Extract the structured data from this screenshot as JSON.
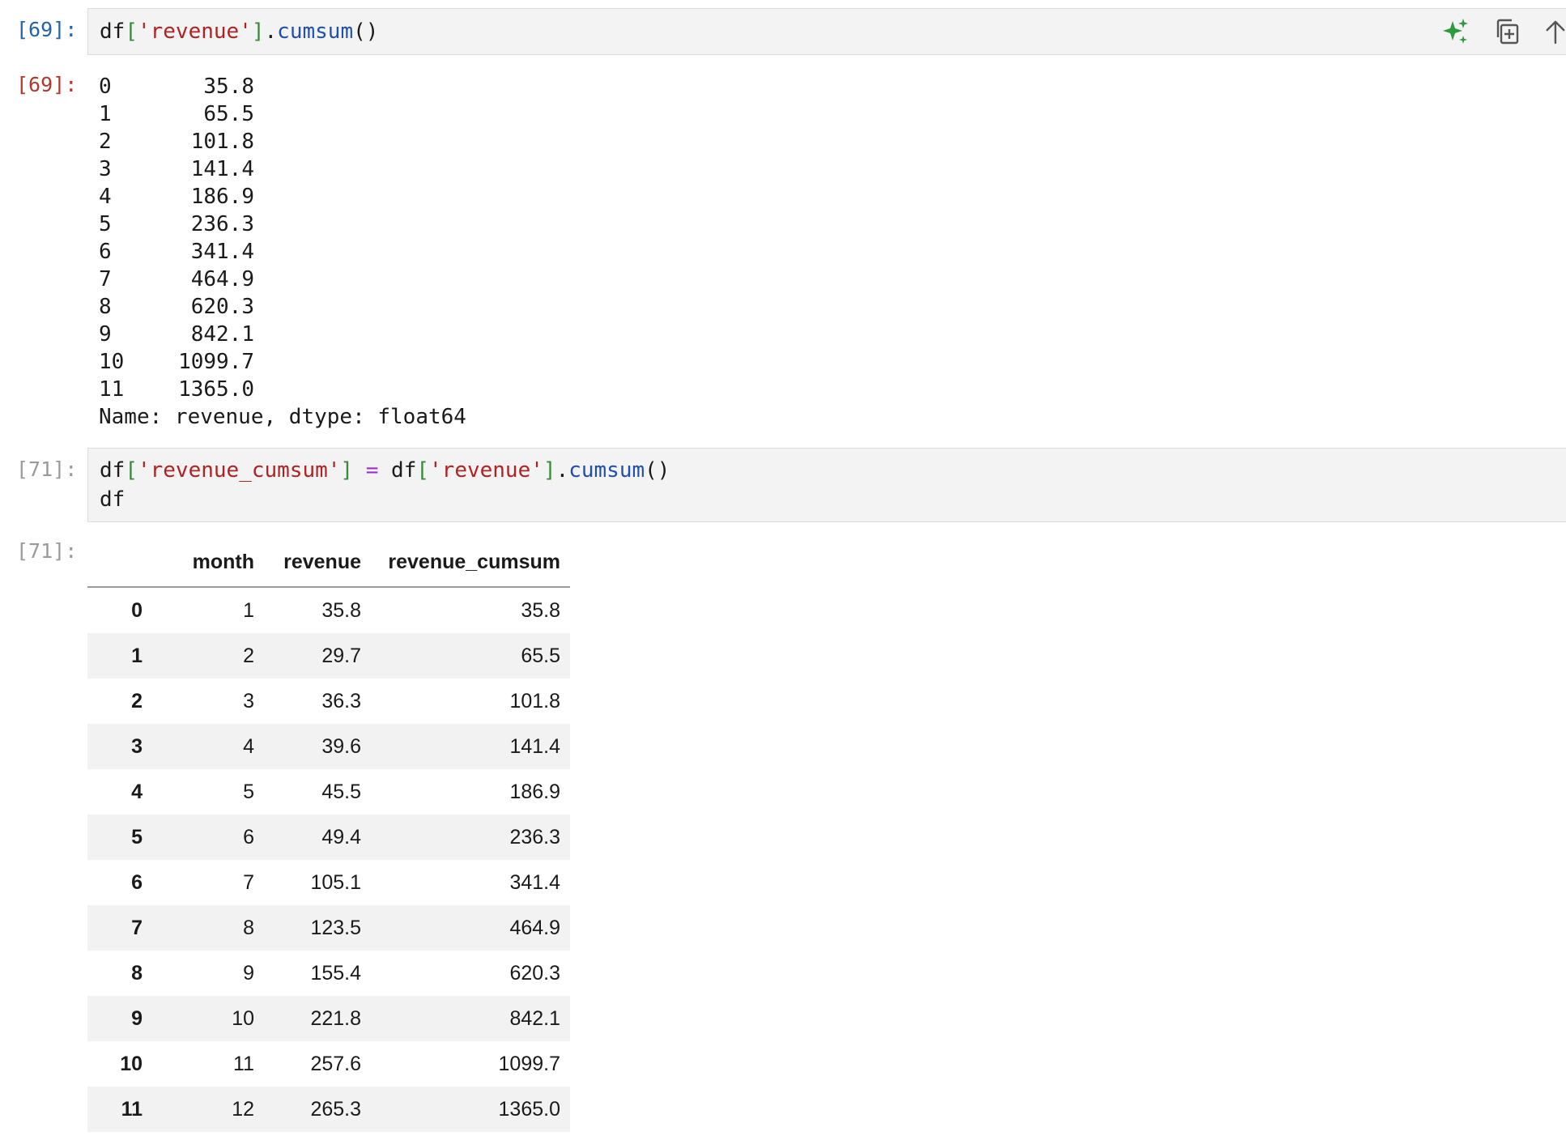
{
  "cell1": {
    "in_prompt": "[69]:",
    "code": {
      "df": "df",
      "open": "[",
      "key": "'revenue'",
      "close": "]",
      "dot": ".",
      "fn": "cumsum",
      "parens": "()"
    },
    "out_prompt": "[69]:",
    "series": [
      {
        "idx": "0",
        "val": "35.8"
      },
      {
        "idx": "1",
        "val": "65.5"
      },
      {
        "idx": "2",
        "val": "101.8"
      },
      {
        "idx": "3",
        "val": "141.4"
      },
      {
        "idx": "4",
        "val": "186.9"
      },
      {
        "idx": "5",
        "val": "236.3"
      },
      {
        "idx": "6",
        "val": "341.4"
      },
      {
        "idx": "7",
        "val": "464.9"
      },
      {
        "idx": "8",
        "val": "620.3"
      },
      {
        "idx": "9",
        "val": "842.1"
      },
      {
        "idx": "10",
        "val": "1099.7"
      },
      {
        "idx": "11",
        "val": "1365.0"
      }
    ],
    "series_footer": "Name: revenue, dtype: float64"
  },
  "cell2": {
    "in_prompt": "[71]:",
    "line1": {
      "df1": "df",
      "open1": "[",
      "key1": "'revenue_cumsum'",
      "close1": "]",
      "eq": " = ",
      "df2": "df",
      "open2": "[",
      "key2": "'revenue'",
      "close2": "]",
      "dot": ".",
      "fn": "cumsum",
      "parens": "()"
    },
    "line2": "df",
    "out_prompt": "[71]:",
    "table": {
      "columns": [
        "month",
        "revenue",
        "revenue_cumsum"
      ],
      "rows": [
        {
          "idx": "0",
          "month": "1",
          "revenue": "35.8",
          "cumsum": "35.8"
        },
        {
          "idx": "1",
          "month": "2",
          "revenue": "29.7",
          "cumsum": "65.5"
        },
        {
          "idx": "2",
          "month": "3",
          "revenue": "36.3",
          "cumsum": "101.8"
        },
        {
          "idx": "3",
          "month": "4",
          "revenue": "39.6",
          "cumsum": "141.4"
        },
        {
          "idx": "4",
          "month": "5",
          "revenue": "45.5",
          "cumsum": "186.9"
        },
        {
          "idx": "5",
          "month": "6",
          "revenue": "49.4",
          "cumsum": "236.3"
        },
        {
          "idx": "6",
          "month": "7",
          "revenue": "105.1",
          "cumsum": "341.4"
        },
        {
          "idx": "7",
          "month": "8",
          "revenue": "123.5",
          "cumsum": "464.9"
        },
        {
          "idx": "8",
          "month": "9",
          "revenue": "155.4",
          "cumsum": "620.3"
        },
        {
          "idx": "9",
          "month": "10",
          "revenue": "221.8",
          "cumsum": "842.1"
        },
        {
          "idx": "10",
          "month": "11",
          "revenue": "257.6",
          "cumsum": "1099.7"
        },
        {
          "idx": "11",
          "month": "12",
          "revenue": "265.3",
          "cumsum": "1365.0"
        }
      ]
    }
  },
  "toolbar": {
    "icons": [
      "sparkle-ai-icon",
      "duplicate-icon",
      "move-up-icon"
    ],
    "ai_color": "#2e9a3e"
  }
}
